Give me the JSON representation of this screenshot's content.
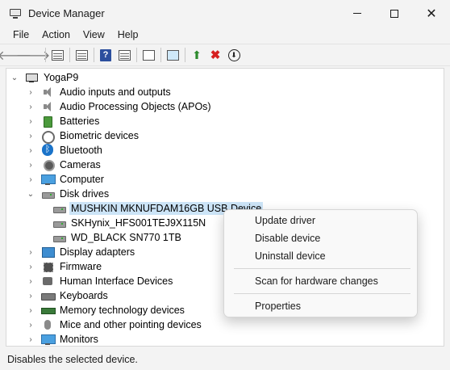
{
  "window": {
    "title": "Device Manager",
    "min_glyph": "",
    "close_glyph": "✕"
  },
  "menubar": [
    "File",
    "Action",
    "View",
    "Help"
  ],
  "toolbar": {
    "back_glyph": "🡐",
    "forward_glyph": "🡒",
    "help_glyph": "?",
    "enable_glyph": "⬆",
    "uninstall_glyph": "✖",
    "update_glyph": "⬇"
  },
  "tree": {
    "root": "YogaP9",
    "collapsed_glyph": "›",
    "expanded_glyph": "⌄",
    "categories": [
      "Audio inputs and outputs",
      "Audio Processing Objects (APOs)",
      "Batteries",
      "Biometric devices",
      "Bluetooth",
      "Cameras",
      "Computer",
      "Disk drives",
      "Display adapters",
      "Firmware",
      "Human Interface Devices",
      "Keyboards",
      "Memory technology devices",
      "Mice and other pointing devices",
      "Monitors"
    ],
    "disk_drives": [
      "MUSHKIN MKNUFDAM16GB USB Device",
      "SKHynix_HFS001TEJ9X115N",
      "WD_BLACK SN770 1TB"
    ]
  },
  "context_menu": {
    "update_driver": "Update driver",
    "disable_device": "Disable device",
    "uninstall_device": "Uninstall device",
    "scan": "Scan for hardware changes",
    "properties": "Properties"
  },
  "status_bar": {
    "text": "Disables the selected device."
  }
}
